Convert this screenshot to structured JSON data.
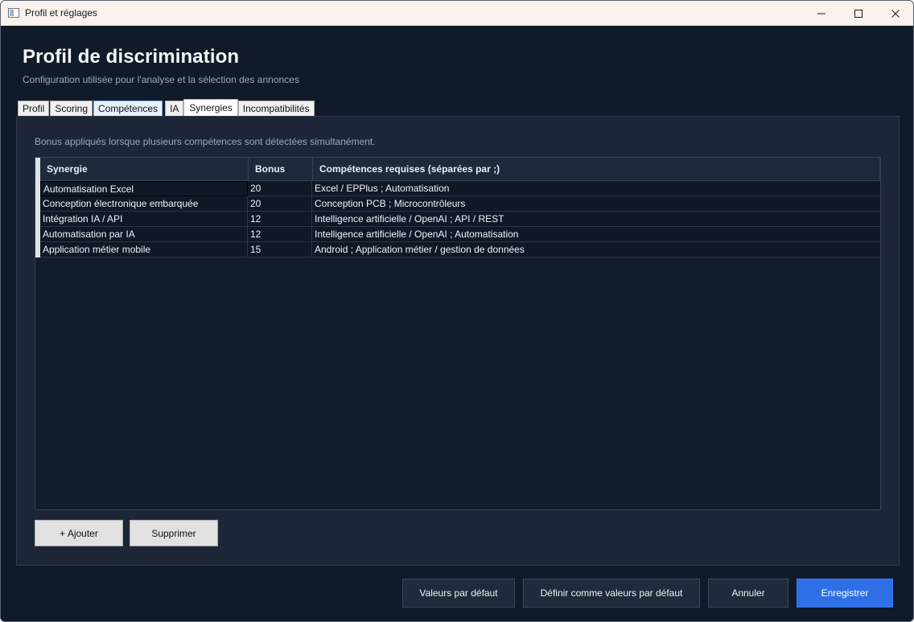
{
  "window": {
    "title": "Profil et réglages",
    "icon": "window-app-icon",
    "controls": [
      "minimize-icon",
      "maximize-icon",
      "close-icon"
    ]
  },
  "header": {
    "title": "Profil de discrimination",
    "subtitle": "Configuration utilisée pour l'analyse et la sélection des annonces"
  },
  "tabs": [
    {
      "label": "Profil"
    },
    {
      "label": "Scoring"
    },
    {
      "label": "Compétences"
    },
    {
      "label": "IA"
    },
    {
      "label": "Synergies",
      "active": true
    },
    {
      "label": "Incompatibilités"
    }
  ],
  "panel": {
    "description": "Bonus appliqués lorsque plusieurs compétences sont détectées simultanément.",
    "grid": {
      "columns": [
        "Synergie",
        "Bonus",
        "Compétences requises (séparées par ;)"
      ],
      "rows": [
        {
          "synergie": "Automatisation Excel",
          "bonus": "20",
          "competences": "Excel / EPPlus ; Automatisation"
        },
        {
          "synergie": "Conception électronique embarquée",
          "bonus": "20",
          "competences": "Conception PCB ; Microcontrôleurs"
        },
        {
          "synergie": "Intégration IA / API",
          "bonus": "12",
          "competences": "Intelligence artificielle / OpenAI ; API / REST"
        },
        {
          "synergie": "Automatisation par IA",
          "bonus": "12",
          "competences": "Intelligence artificielle / OpenAI ; Automatisation"
        },
        {
          "synergie": "Application métier mobile",
          "bonus": "15",
          "competences": "Android ; Application métier / gestion de données"
        }
      ]
    },
    "add_label": "+ Ajouter",
    "delete_label": "Supprimer"
  },
  "footer": {
    "defaults_label": "Valeurs par défaut",
    "set_defaults_label": "Définir comme valeurs par défaut",
    "cancel_label": "Annuler",
    "save_label": "Enregistrer"
  },
  "colors": {
    "background": "#111a28",
    "panel": "#1c2636",
    "accent": "#2f6fe6",
    "titlebar": "#f8f1ec"
  }
}
